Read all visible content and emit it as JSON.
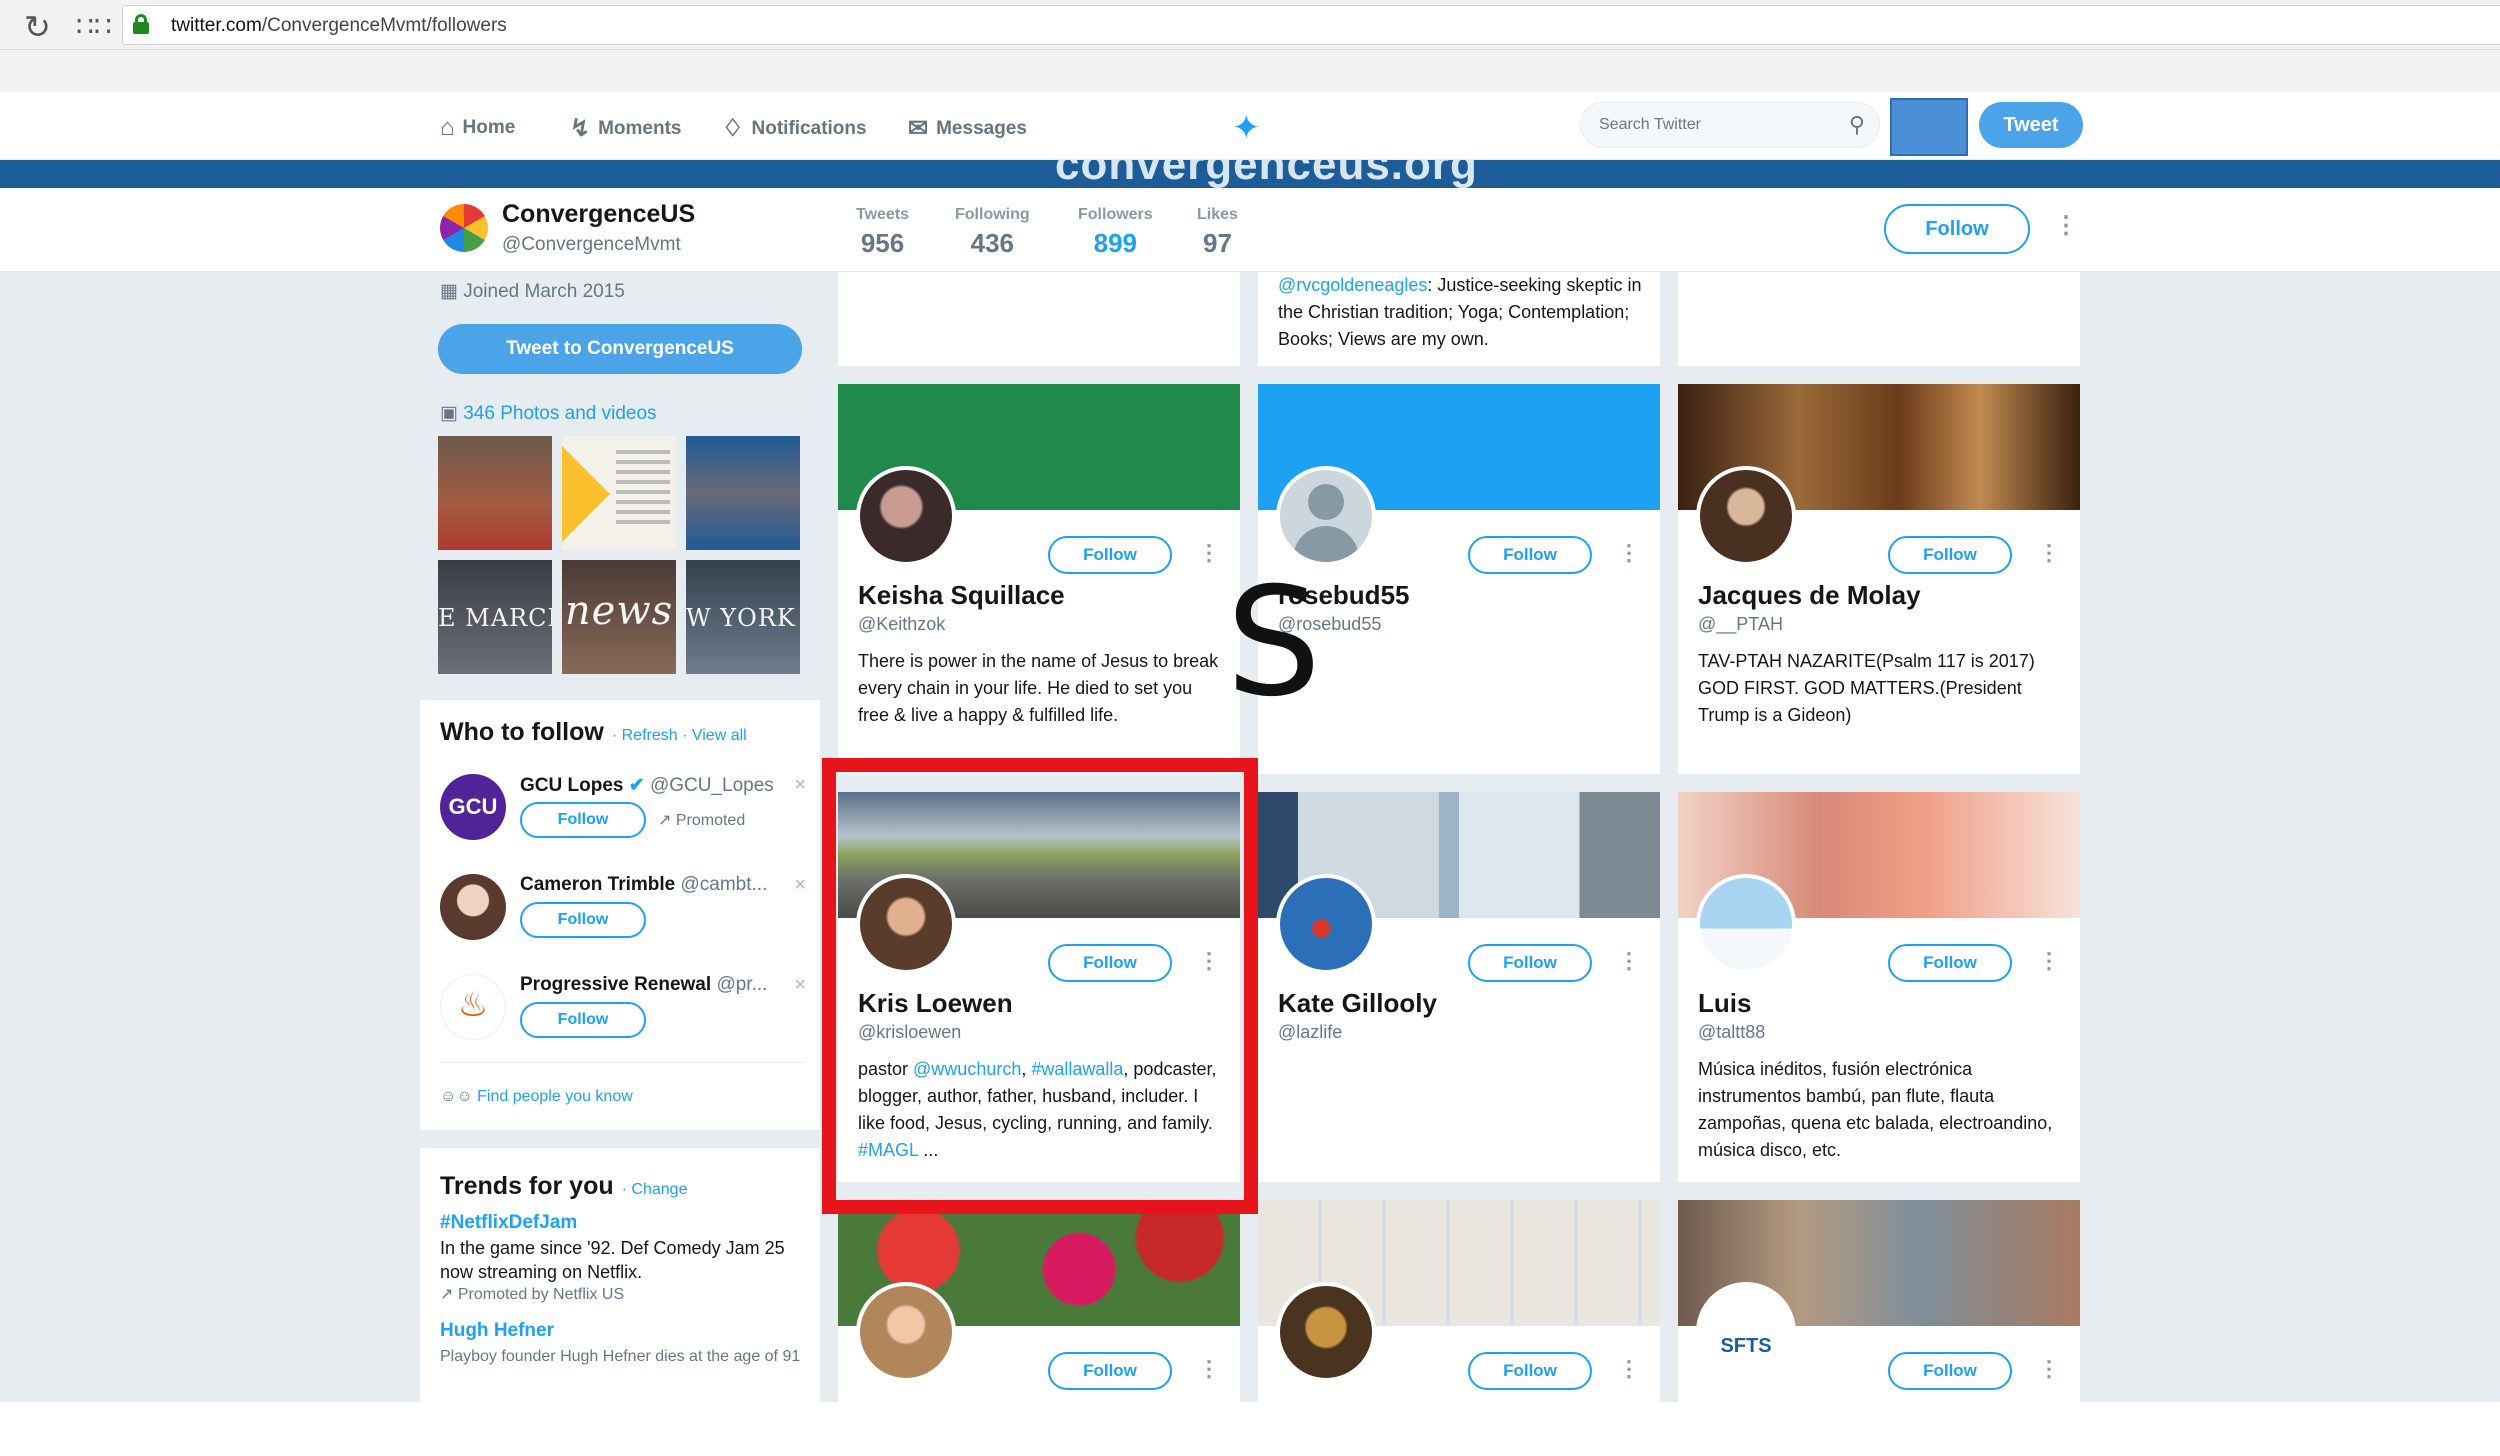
{
  "browser": {
    "url_domain": "twitter.com",
    "url_path": "/ConvergenceMvmt/followers"
  },
  "nav": {
    "home": "Home",
    "moments": "Moments",
    "notifications": "Notifications",
    "messages": "Messages",
    "search_placeholder": "Search Twitter",
    "tweet_button": "Tweet"
  },
  "banner_text": "convergenceus.org",
  "profile": {
    "name": "ConvergenceUS",
    "handle": "@ConvergenceMvmt",
    "stats": [
      {
        "label": "Tweets",
        "value": "956"
      },
      {
        "label": "Following",
        "value": "436"
      },
      {
        "label": "Followers",
        "value": "899"
      },
      {
        "label": "Likes",
        "value": "97"
      }
    ],
    "follow_label": "Follow",
    "joined": "Joined March 2015",
    "tweet_to": "Tweet to ConvergenceUS",
    "photos_label": "346 Photos and videos"
  },
  "thumbs": [
    "",
    "",
    "",
    "E MARCH",
    "news",
    "W YORK CI"
  ],
  "who_to_follow": {
    "title": "Who to follow",
    "links": "· Refresh · View all",
    "items": [
      {
        "name": "GCU Lopes",
        "handle": "@GCU_Lopes",
        "follow": "Follow",
        "promoted": "Promoted",
        "avatar_text": "GCU"
      },
      {
        "name": "Cameron Trimble",
        "handle": "@cambt...",
        "follow": "Follow"
      },
      {
        "name": "Progressive Renewal",
        "handle": "@pr...",
        "follow": "Follow"
      }
    ],
    "find_people": "Find people you know"
  },
  "trends": {
    "title": "Trends for you",
    "change": "· Change",
    "items": [
      {
        "name": "#NetflixDefJam",
        "desc": "In the game since '92. Def Comedy Jam 25 now streaming on Netflix.",
        "meta": "Promoted by Netflix US"
      },
      {
        "name": "Hugh Hefner",
        "desc": "Playboy founder Hugh Hefner dies at the age of 91"
      }
    ]
  },
  "top_bio": {
    "handle": "@rvcgoldeneagles",
    "text": ": Justice-seeking skeptic in the Christian tradition; Yoga; Contemplation; Books; Views are my own."
  },
  "cards": [
    {
      "name": "Keisha Squillace",
      "handle": "@Keithzok",
      "follow": "Follow",
      "bio": "There is power in the name of Jesus to break every chain in your life. He died to set you free & live a happy & fulfilled life.",
      "header_color": "#1f8a4c"
    },
    {
      "name": "rosebud55",
      "handle": "@rosebud55",
      "follow": "Follow",
      "bio": "",
      "header_color": "#1da1f2"
    },
    {
      "name": "Jacques de Molay",
      "handle": "@__PTAH",
      "follow": "Follow",
      "bio": "TAV-PTAH NAZARITE(Psalm 117 is 2017) GOD FIRST. GOD MATTERS.(President Trump is a Gideon)",
      "header_color": "#6b3b1a"
    },
    {
      "name": "Kris Loewen",
      "handle": "@krisloewen",
      "follow": "Follow",
      "bio_pre": "pastor ",
      "bio_link1": "@wwuchurch",
      "bio_mid": ", ",
      "bio_link2": "#wallawalla",
      "bio_post": ", podcaster, blogger, author, father, husband, includer. I like food, Jesus, cycling, running, and family. ",
      "bio_link3": "#MAGL",
      "bio_end": " ...",
      "header_color": "#7f8f78"
    },
    {
      "name": "Kate Gillooly",
      "handle": "@lazlife",
      "follow": "Follow",
      "bio": "",
      "header_color": "#dfe7ee"
    },
    {
      "name": "Luis",
      "handle": "@taltt88",
      "follow": "Follow",
      "bio": "Música inéditos, fusión electrónica instrumentos bambú, pan flute, flauta zampoñas, quena etc balada, electroandino, música disco, etc.",
      "header_color": "#e8b8a8"
    },
    {
      "name": "",
      "handle": "",
      "follow": "Follow",
      "bio": "",
      "header_color": "#c8202a"
    },
    {
      "name": "",
      "handle": "",
      "follow": "Follow",
      "bio": "",
      "header_color": "#e9e6df"
    },
    {
      "name": "",
      "handle": "",
      "follow": "Follow",
      "bio": "",
      "header_color": "#8a7d72",
      "avatar_text": "SFTS"
    }
  ],
  "annotation": "S"
}
